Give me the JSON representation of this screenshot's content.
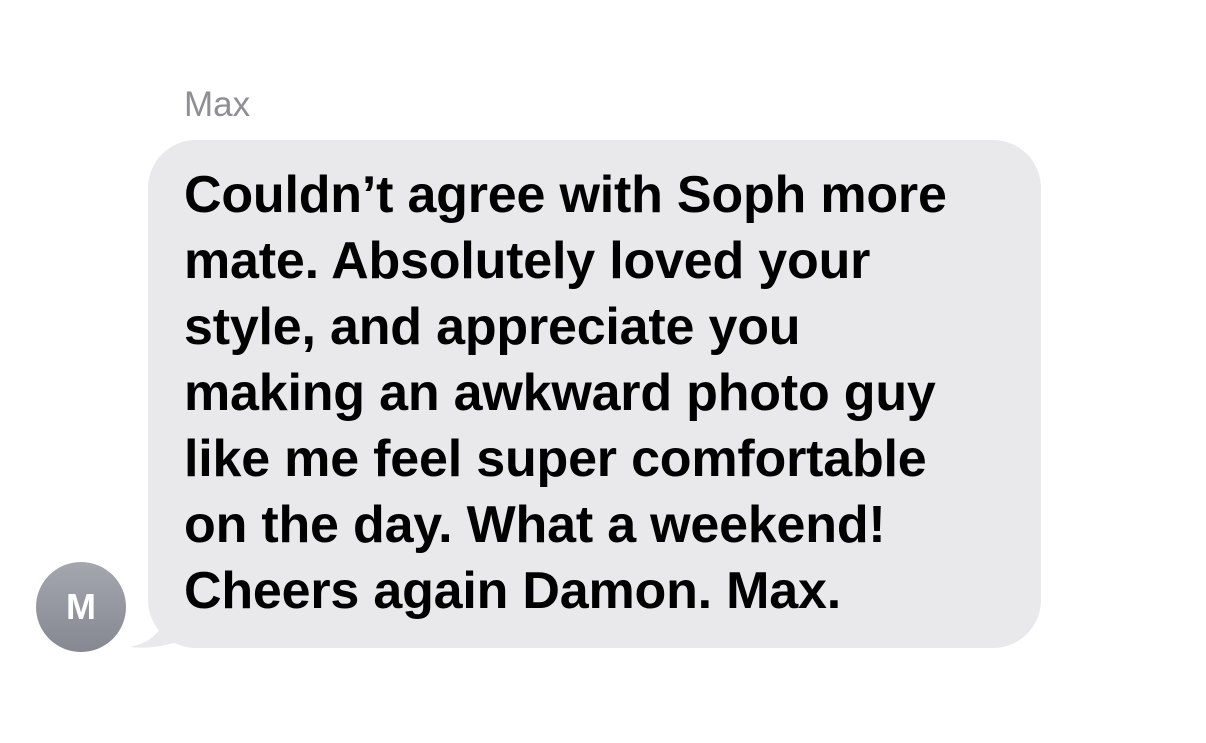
{
  "message": {
    "sender_name": "Max",
    "avatar_initial": "M",
    "text": "Couldn’t agree with Soph more\nmate. Absolutely loved your\nstyle, and appreciate you\nmaking an awkward photo guy\nlike me feel super comfortable\non the day. What a weekend!\nCheers again Damon. Max.",
    "bubble_color": "#e9e9eb",
    "text_color": "#000000",
    "sender_name_color": "#8e8e93",
    "avatar_color": "#959aa1"
  }
}
